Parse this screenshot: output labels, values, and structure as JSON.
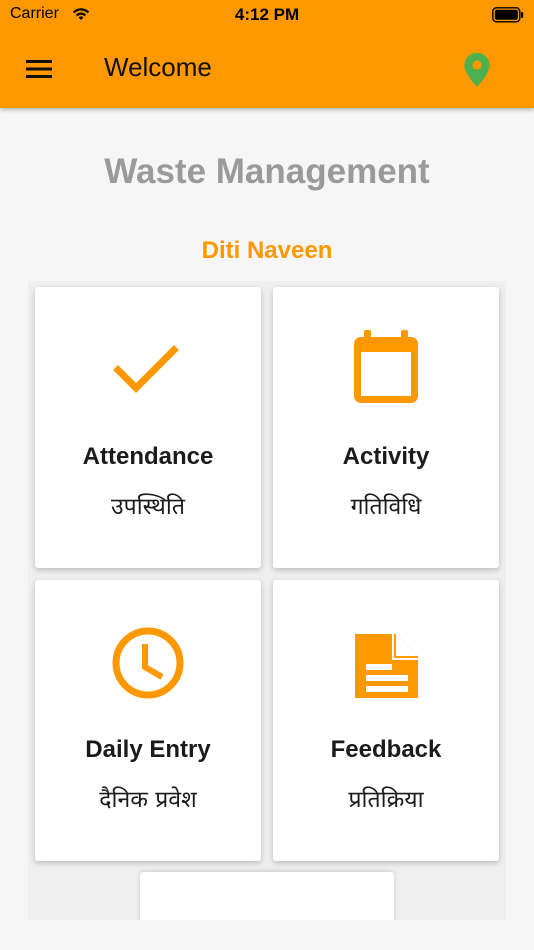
{
  "status_bar": {
    "carrier": "Carrier",
    "time": "4:12 PM"
  },
  "app_bar": {
    "title": "Welcome",
    "menu_icon": "hamburger-menu-icon",
    "location_icon": "location-pin-icon",
    "background_color": "#fe9800",
    "location_icon_color": "#4caf50"
  },
  "main": {
    "heading": "Waste Management",
    "user_name": "Diti Naveen",
    "accent_color": "#fe9800",
    "cards": [
      {
        "icon": "checkmark-icon",
        "label_en": "Attendance",
        "label_hi": "उपस्थिति"
      },
      {
        "icon": "calendar-icon",
        "label_en": "Activity",
        "label_hi": "गतिविधि"
      },
      {
        "icon": "clock-icon",
        "label_en": "Daily Entry",
        "label_hi": "दैनिक प्रवेश"
      },
      {
        "icon": "document-icon",
        "label_en": "Feedback",
        "label_hi": "प्रतिक्रिया"
      }
    ]
  }
}
